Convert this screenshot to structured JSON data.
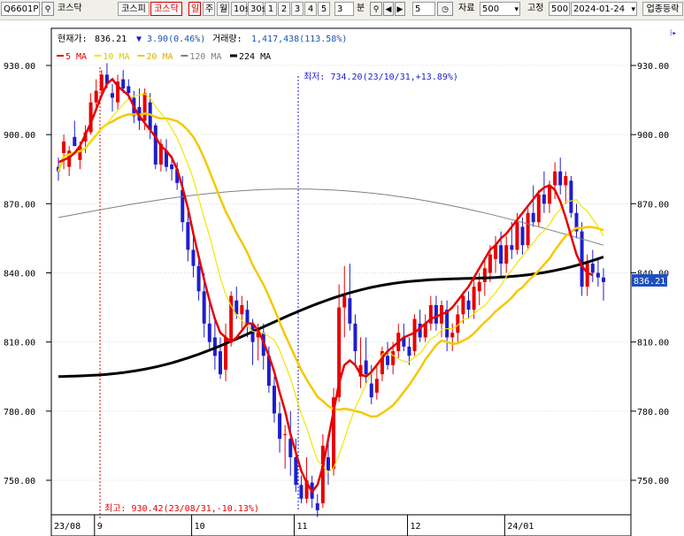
{
  "toolbar": {
    "code": "Q6601P",
    "market_label": "코스닥",
    "buttons": [
      "코스피",
      "코스닥"
    ],
    "period_buttons": [
      "일",
      "주",
      "월",
      "10s",
      "30s",
      "1",
      "2",
      "3",
      "4",
      "5"
    ],
    "interval_value": "3",
    "interval_unit": "분",
    "step_value": "5",
    "count_label": "자료",
    "count_value": "500",
    "fixed_label": "고정",
    "fixed_value": "500",
    "date_value": "2024-01-24",
    "sector_button": "업종등락"
  },
  "colors": {
    "up": "#e60000",
    "down": "#1e1ecc",
    "ma5": "#e60000",
    "ma10": "#f2e600",
    "ma20": "#f5c800",
    "ma120": "#808080",
    "ma224": "#000000",
    "info_value": "#1a56b0"
  },
  "info": {
    "price_label": "현재가:",
    "price": "836.21",
    "change_arrow": "▼",
    "change": "3.90(0.46%)",
    "volume_label": "거래량:",
    "volume": "1,417,438(113.58%)"
  },
  "chart_data": {
    "type": "candlestick",
    "legend": [
      {
        "name": "5 MA",
        "color": "#e60000"
      },
      {
        "name": "10 MA",
        "color": "#f2e600"
      },
      {
        "name": "20 MA",
        "color": "#f5c800"
      },
      {
        "name": "120 MA",
        "color": "#808080"
      },
      {
        "name": "224 MA",
        "color": "#000000"
      }
    ],
    "y_ticks": [
      930,
      900,
      870,
      840,
      810,
      780,
      750
    ],
    "ylim": [
      736,
      940
    ],
    "y_tick_labels": [
      "930.00",
      "900.00",
      "870.00",
      "840.00",
      "810.00",
      "780.00",
      "750.00"
    ],
    "x_tick_labels": [
      "23/08",
      "9",
      "10",
      "11",
      "12",
      "24/01"
    ],
    "last_price_label": "836.21",
    "annotations": {
      "min": "최저: 734.20(23/10/31,+13.89%)",
      "max": "최고: 930.42(23/08/31,-10.13%)"
    },
    "candles": [
      {
        "o": 886,
        "h": 890,
        "l": 880,
        "c": 884
      },
      {
        "o": 892,
        "h": 900,
        "l": 885,
        "c": 897
      },
      {
        "o": 886,
        "h": 895,
        "l": 882,
        "c": 893
      },
      {
        "o": 899,
        "h": 906,
        "l": 895,
        "c": 895
      },
      {
        "o": 889,
        "h": 897,
        "l": 885,
        "c": 895
      },
      {
        "o": 897,
        "h": 904,
        "l": 892,
        "c": 901
      },
      {
        "o": 901,
        "h": 918,
        "l": 900,
        "c": 914
      },
      {
        "o": 914,
        "h": 924,
        "l": 911,
        "c": 919
      },
      {
        "o": 919,
        "h": 928,
        "l": 917,
        "c": 926
      },
      {
        "o": 926,
        "h": 931,
        "l": 920,
        "c": 922
      },
      {
        "o": 918,
        "h": 922,
        "l": 910,
        "c": 916
      },
      {
        "o": 914,
        "h": 926,
        "l": 911,
        "c": 923
      },
      {
        "o": 924,
        "h": 928,
        "l": 918,
        "c": 920
      },
      {
        "o": 921,
        "h": 924,
        "l": 915,
        "c": 918
      },
      {
        "o": 916,
        "h": 919,
        "l": 905,
        "c": 908
      },
      {
        "o": 912,
        "h": 920,
        "l": 902,
        "c": 906
      },
      {
        "o": 906,
        "h": 920,
        "l": 902,
        "c": 918
      },
      {
        "o": 914,
        "h": 918,
        "l": 898,
        "c": 902
      },
      {
        "o": 904,
        "h": 905,
        "l": 885,
        "c": 887
      },
      {
        "o": 887,
        "h": 898,
        "l": 884,
        "c": 896
      },
      {
        "o": 893,
        "h": 898,
        "l": 884,
        "c": 886
      },
      {
        "o": 887,
        "h": 891,
        "l": 880,
        "c": 885
      },
      {
        "o": 885,
        "h": 888,
        "l": 876,
        "c": 879
      },
      {
        "o": 876,
        "h": 882,
        "l": 858,
        "c": 862
      },
      {
        "o": 862,
        "h": 868,
        "l": 845,
        "c": 850
      },
      {
        "o": 850,
        "h": 858,
        "l": 838,
        "c": 843
      },
      {
        "o": 843,
        "h": 848,
        "l": 828,
        "c": 832
      },
      {
        "o": 832,
        "h": 840,
        "l": 812,
        "c": 818
      },
      {
        "o": 818,
        "h": 828,
        "l": 806,
        "c": 810
      },
      {
        "o": 812,
        "h": 820,
        "l": 798,
        "c": 804
      },
      {
        "o": 806,
        "h": 812,
        "l": 794,
        "c": 796
      },
      {
        "o": 798,
        "h": 818,
        "l": 793,
        "c": 812
      },
      {
        "o": 810,
        "h": 832,
        "l": 808,
        "c": 830
      },
      {
        "o": 828,
        "h": 834,
        "l": 820,
        "c": 822
      },
      {
        "o": 822,
        "h": 830,
        "l": 815,
        "c": 826
      },
      {
        "o": 824,
        "h": 828,
        "l": 812,
        "c": 818
      },
      {
        "o": 818,
        "h": 820,
        "l": 800,
        "c": 810
      },
      {
        "o": 812,
        "h": 818,
        "l": 802,
        "c": 816
      },
      {
        "o": 814,
        "h": 818,
        "l": 798,
        "c": 804
      },
      {
        "o": 804,
        "h": 808,
        "l": 788,
        "c": 791
      },
      {
        "o": 791,
        "h": 795,
        "l": 775,
        "c": 779
      },
      {
        "o": 779,
        "h": 784,
        "l": 762,
        "c": 768
      },
      {
        "o": 770,
        "h": 774,
        "l": 755,
        "c": 770
      },
      {
        "o": 768,
        "h": 780,
        "l": 752,
        "c": 760
      },
      {
        "o": 760,
        "h": 768,
        "l": 745,
        "c": 748
      },
      {
        "o": 748,
        "h": 752,
        "l": 740,
        "c": 742
      },
      {
        "o": 742,
        "h": 760,
        "l": 740,
        "c": 750
      },
      {
        "o": 749,
        "h": 752,
        "l": 738,
        "c": 742
      },
      {
        "o": 740,
        "h": 744,
        "l": 734,
        "c": 737
      },
      {
        "o": 740,
        "h": 770,
        "l": 738,
        "c": 765
      },
      {
        "o": 760,
        "h": 770,
        "l": 748,
        "c": 754
      },
      {
        "o": 755,
        "h": 790,
        "l": 752,
        "c": 786
      },
      {
        "o": 786,
        "h": 835,
        "l": 784,
        "c": 825
      },
      {
        "o": 825,
        "h": 843,
        "l": 812,
        "c": 830
      },
      {
        "o": 829,
        "h": 844,
        "l": 815,
        "c": 818
      },
      {
        "o": 818,
        "h": 822,
        "l": 800,
        "c": 806
      },
      {
        "o": 795,
        "h": 812,
        "l": 790,
        "c": 800
      },
      {
        "o": 802,
        "h": 812,
        "l": 792,
        "c": 796
      },
      {
        "o": 792,
        "h": 800,
        "l": 783,
        "c": 786
      },
      {
        "o": 788,
        "h": 800,
        "l": 785,
        "c": 794
      },
      {
        "o": 796,
        "h": 808,
        "l": 793,
        "c": 806
      },
      {
        "o": 804,
        "h": 810,
        "l": 798,
        "c": 800
      },
      {
        "o": 800,
        "h": 810,
        "l": 796,
        "c": 806
      },
      {
        "o": 806,
        "h": 818,
        "l": 803,
        "c": 814
      },
      {
        "o": 812,
        "h": 818,
        "l": 806,
        "c": 808
      },
      {
        "o": 808,
        "h": 812,
        "l": 800,
        "c": 804
      },
      {
        "o": 806,
        "h": 822,
        "l": 804,
        "c": 820
      },
      {
        "o": 818,
        "h": 824,
        "l": 810,
        "c": 812
      },
      {
        "o": 812,
        "h": 822,
        "l": 810,
        "c": 818
      },
      {
        "o": 818,
        "h": 830,
        "l": 815,
        "c": 826
      },
      {
        "o": 826,
        "h": 830,
        "l": 815,
        "c": 818
      },
      {
        "o": 818,
        "h": 828,
        "l": 812,
        "c": 826
      },
      {
        "o": 824,
        "h": 828,
        "l": 806,
        "c": 812
      },
      {
        "o": 812,
        "h": 818,
        "l": 806,
        "c": 814
      },
      {
        "o": 814,
        "h": 826,
        "l": 810,
        "c": 822
      },
      {
        "o": 822,
        "h": 832,
        "l": 818,
        "c": 830
      },
      {
        "o": 828,
        "h": 832,
        "l": 820,
        "c": 824
      },
      {
        "o": 824,
        "h": 838,
        "l": 820,
        "c": 834
      },
      {
        "o": 832,
        "h": 840,
        "l": 826,
        "c": 836
      },
      {
        "o": 836,
        "h": 846,
        "l": 830,
        "c": 842
      },
      {
        "o": 840,
        "h": 852,
        "l": 836,
        "c": 848
      },
      {
        "o": 846,
        "h": 856,
        "l": 840,
        "c": 852
      },
      {
        "o": 852,
        "h": 858,
        "l": 838,
        "c": 844
      },
      {
        "o": 844,
        "h": 856,
        "l": 840,
        "c": 852
      },
      {
        "o": 852,
        "h": 862,
        "l": 846,
        "c": 850
      },
      {
        "o": 850,
        "h": 866,
        "l": 848,
        "c": 862
      },
      {
        "o": 860,
        "h": 864,
        "l": 848,
        "c": 852
      },
      {
        "o": 852,
        "h": 868,
        "l": 850,
        "c": 866
      },
      {
        "o": 866,
        "h": 878,
        "l": 860,
        "c": 862
      },
      {
        "o": 862,
        "h": 876,
        "l": 860,
        "c": 874
      },
      {
        "o": 874,
        "h": 884,
        "l": 866,
        "c": 870
      },
      {
        "o": 870,
        "h": 880,
        "l": 866,
        "c": 878
      },
      {
        "o": 878,
        "h": 888,
        "l": 872,
        "c": 884
      },
      {
        "o": 884,
        "h": 890,
        "l": 874,
        "c": 878
      },
      {
        "o": 878,
        "h": 884,
        "l": 870,
        "c": 882
      },
      {
        "o": 880,
        "h": 882,
        "l": 864,
        "c": 866
      },
      {
        "o": 866,
        "h": 870,
        "l": 855,
        "c": 858
      },
      {
        "o": 858,
        "h": 862,
        "l": 830,
        "c": 834
      },
      {
        "o": 834,
        "h": 848,
        "l": 830,
        "c": 844
      },
      {
        "o": 844,
        "h": 850,
        "l": 836,
        "c": 840
      },
      {
        "o": 840,
        "h": 846,
        "l": 834,
        "c": 838
      },
      {
        "o": 838,
        "h": 842,
        "l": 828,
        "c": 836
      }
    ],
    "ma5": [
      888,
      889,
      890,
      892,
      895,
      900,
      905,
      911,
      917,
      922,
      924,
      921,
      919,
      917,
      912,
      908,
      905,
      902,
      899,
      895,
      893,
      890,
      885,
      877,
      868,
      857,
      847,
      837,
      828,
      820,
      814,
      812,
      810,
      812,
      815,
      818,
      818,
      815,
      810,
      804,
      797,
      788,
      780,
      770,
      762,
      754,
      749,
      745,
      748,
      756,
      768,
      780,
      792,
      800,
      802,
      800,
      796,
      795,
      797,
      800,
      803,
      806,
      808,
      810,
      812,
      813,
      814,
      816,
      818,
      820,
      821,
      822,
      823,
      825,
      828,
      831,
      834,
      838,
      842,
      846,
      850,
      852,
      855,
      857,
      860,
      863,
      866,
      869,
      872,
      875,
      877,
      878,
      876,
      871,
      864,
      856,
      848,
      843,
      840,
      839
    ]
  }
}
